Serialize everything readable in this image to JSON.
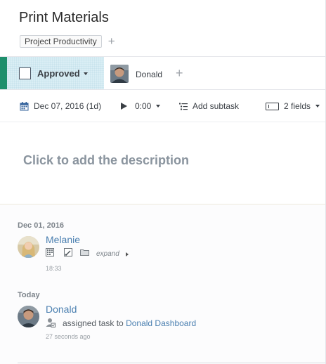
{
  "task": {
    "title": "Print Materials",
    "tags": [
      "Project Productivity"
    ],
    "tag_add": "+"
  },
  "status": {
    "label": "Approved",
    "accent_color": "#1e8f6c",
    "bg_color": "#daeef5"
  },
  "assignee": {
    "name": "Donald",
    "add": "+"
  },
  "toolbar": {
    "date": "Dec 07, 2016 (1d)",
    "time": "0:00",
    "add_subtask": "Add subtask",
    "fields": "2 fields"
  },
  "description": {
    "placeholder": "Click to add the description"
  },
  "stream": {
    "days": [
      {
        "label": "Dec 01, 2016",
        "entries": [
          {
            "user": "Melanie",
            "icons": [
              "grid-icon",
              "brush-icon",
              "folder-icon"
            ],
            "expand": "expand",
            "time": "18:33"
          }
        ]
      },
      {
        "label": "Today",
        "entries": [
          {
            "user": "Donald",
            "action": "assigned task to",
            "target": "Donald Dashboard",
            "time": "27 seconds ago"
          }
        ]
      }
    ]
  },
  "colors": {
    "link": "#4a7fb0",
    "muted": "#8a949e"
  }
}
